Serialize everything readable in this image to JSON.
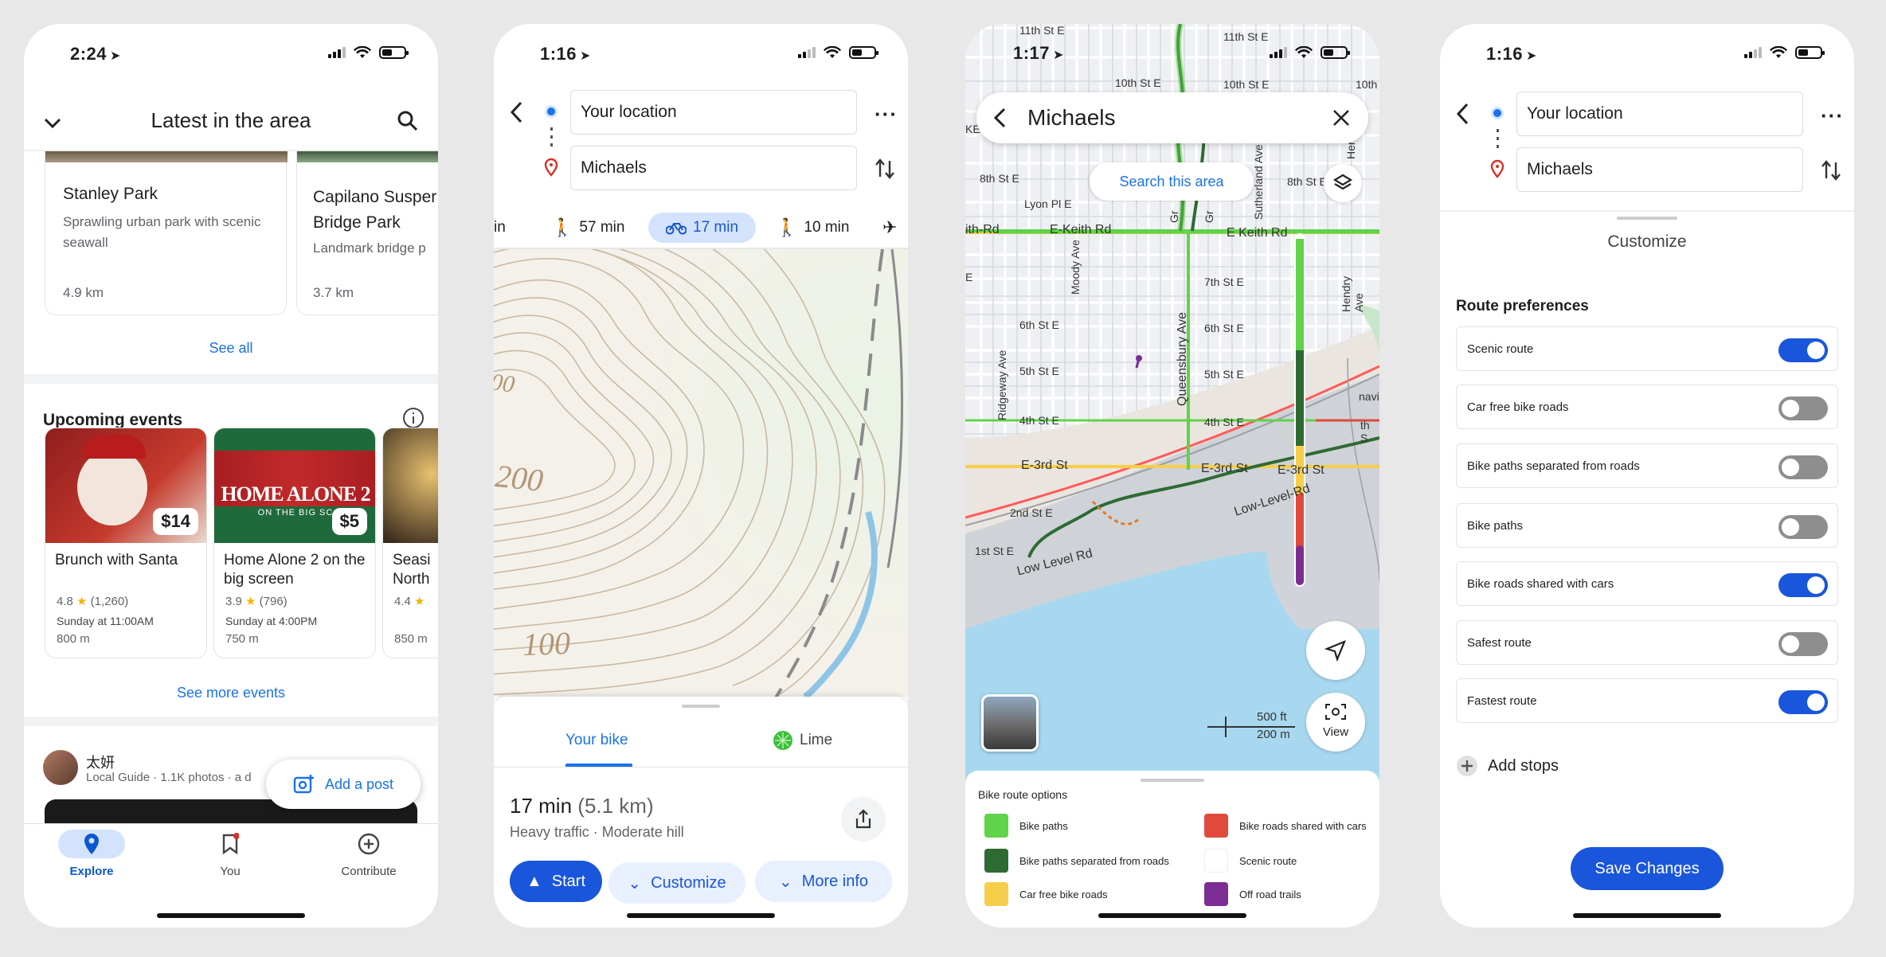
{
  "phone1": {
    "time": "2:24",
    "header_title": "Latest in the area",
    "places": [
      {
        "name": "Stanley Park",
        "desc": "Sprawling urban park with scenic seawall",
        "distance": "4.9 km"
      },
      {
        "name": "Capilano Suspension Bridge Park",
        "name_visible": "Capilano Susper Bridge Park",
        "desc": "Landmark bridge p",
        "distance": "3.7 km"
      }
    ],
    "see_all": "See all",
    "events_title": "Upcoming events",
    "events": [
      {
        "title": "Brunch with Santa",
        "price": "$14",
        "rating": "4.8",
        "reviews": "(1,260)",
        "when": "Sunday at 11:00AM",
        "distance": "800 m"
      },
      {
        "title": "Home Alone 2 on the big screen",
        "price": "$5",
        "rating": "3.9",
        "reviews": "(796)",
        "when": "Sunday at 4:00PM",
        "distance": "750 m",
        "poster_text": "HOME ALONE 2",
        "poster_sub": "ON THE BIG SC"
      },
      {
        "title": "Seasi North",
        "rating": "4.4",
        "distance": "850 m"
      }
    ],
    "see_more_events": "See more events",
    "post_author": "太妍",
    "post_meta": "Local Guide · 1.1K photos · a d",
    "add_post": "Add a post",
    "nav": [
      {
        "label": "Explore"
      },
      {
        "label": "You"
      },
      {
        "label": "Contribute"
      }
    ]
  },
  "phone2": {
    "time": "1:16",
    "origin": "Your location",
    "destination": "Michaels",
    "modes": [
      {
        "label": "in",
        "icon": "car-icon"
      },
      {
        "label": "57 min",
        "icon": "walk-icon"
      },
      {
        "label": "17 min",
        "icon": "bike-icon",
        "selected": true
      },
      {
        "label": "10 min",
        "icon": "transit-icon"
      },
      {
        "label": "",
        "icon": "flight-icon"
      }
    ],
    "map_labels": [
      "00",
      "200",
      "100"
    ],
    "tabs": [
      "Your bike",
      "Lime"
    ],
    "duration": "17 min",
    "distance": "(5.1 km)",
    "conditions": "Heavy traffic · Moderate hill",
    "start_label": "Start",
    "customize_label": "Customize",
    "more_info_label": "More info"
  },
  "phone3": {
    "time": "1:17",
    "search_text": "Michaels",
    "search_area": "Search this area",
    "streets": [
      "11th St E",
      "11th St E",
      "10th St E",
      "10th St E",
      "10th",
      "8th St E",
      "8th St E",
      "Lyon Pl E",
      "E-Keith Rd",
      "E Keith Rd",
      "ith-Rd",
      "7th St E",
      "6th St E",
      "6th St E",
      "5th St E",
      "5th St E",
      "4th St E",
      "4th St E",
      "E-3rd St",
      "E-3rd St",
      "E-3rd St",
      "2nd St E",
      "1st St E",
      "Low Level Rd",
      "Low-Level-Rd",
      "Moody Ave",
      "Queensbury Ave",
      "Ridgeway Ave",
      "Sutherland Ave",
      "Hendry Ave",
      "KE",
      "E",
      "E",
      "navi",
      "th S",
      "Gr",
      "Gr",
      "Her"
    ],
    "scale_ft": "500 ft",
    "scale_m": "200 m",
    "view_label": "View",
    "options_title": "Bike route options",
    "options": [
      {
        "label": "Bike paths",
        "color": "#5fd34a"
      },
      {
        "label": "Bike roads shared with cars",
        "color": "#e04a3c"
      },
      {
        "label": "Bike paths separated from roads",
        "color": "#2e6b33"
      },
      {
        "label": "Scenic route",
        "color": "#ffffff"
      },
      {
        "label": "Car free bike roads",
        "color": "#f6ce49"
      },
      {
        "label": "Off road trails",
        "color": "#7b2d93"
      }
    ]
  },
  "phone4": {
    "time": "1:16",
    "origin": "Your location",
    "destination": "Michaels",
    "title": "Customize",
    "section": "Route preferences",
    "prefs": [
      {
        "label": "Scenic route",
        "on": true
      },
      {
        "label": "Car free bike roads",
        "on": false
      },
      {
        "label": "Bike paths separated from roads",
        "on": false
      },
      {
        "label": "Bike paths",
        "on": false
      },
      {
        "label": "Bike roads shared with cars",
        "on": true
      },
      {
        "label": "Safest route",
        "on": false
      },
      {
        "label": "Fastest route",
        "on": true
      }
    ],
    "add_stops": "Add stops",
    "save": "Save Changes"
  },
  "colors": {
    "accent": "#1a73e8",
    "toggle_on": "#1a56db",
    "toggle_off": "#8e8e8e",
    "pill_bg": "#d3e3fd"
  }
}
